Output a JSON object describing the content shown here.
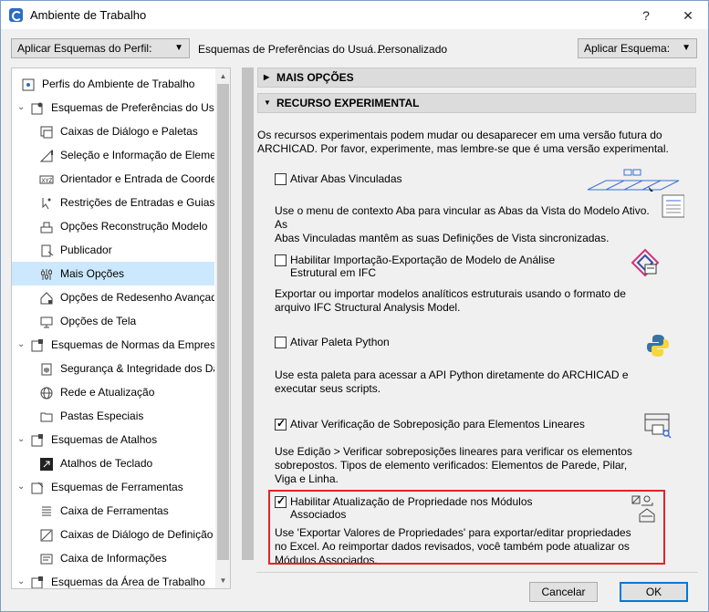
{
  "window": {
    "title": "Ambiente de Trabalho",
    "help_label": "?",
    "close_label": "✕"
  },
  "toolbar": {
    "apply_profile_label": "Aplicar Esquemas do Perfil:",
    "scheme_label": "Esquemas de Preferências do Usuá...:",
    "scheme_value": "Personalizado",
    "apply_scheme_label": "Aplicar Esquema:"
  },
  "tree": {
    "items": [
      {
        "label": "Perfis do Ambiente de Trabalho",
        "icon": "profiles-icon",
        "expand": ""
      },
      {
        "label": "Esquemas de Preferências do Usuá",
        "icon": "user-prefs-icon",
        "expand": "⌄"
      },
      {
        "label": "Caixas de Diálogo e Paletas",
        "icon": "dialogs-icon",
        "expand": ""
      },
      {
        "label": "Seleção e Informação de Element",
        "icon": "selection-info-icon",
        "expand": ""
      },
      {
        "label": "Orientador e Entrada de Coorder",
        "icon": "xyz-icon",
        "expand": ""
      },
      {
        "label": "Restrições de Entradas e Guias",
        "icon": "constraints-icon",
        "expand": ""
      },
      {
        "label": "Opções Reconstrução Modelo",
        "icon": "rebuild-icon",
        "expand": ""
      },
      {
        "label": "Publicador",
        "icon": "publisher-icon",
        "expand": ""
      },
      {
        "label": "Mais Opções",
        "icon": "more-options-icon",
        "expand": ""
      },
      {
        "label": "Opções de Redesenho Avançada",
        "icon": "redraw-icon",
        "expand": ""
      },
      {
        "label": "Opções de Tela",
        "icon": "screen-icon",
        "expand": ""
      },
      {
        "label": "Esquemas de Normas da Empresa",
        "icon": "company-standards-icon",
        "expand": "⌄"
      },
      {
        "label": "Segurança & Integridade dos Da",
        "icon": "security-icon",
        "expand": ""
      },
      {
        "label": "Rede e Atualização",
        "icon": "network-icon",
        "expand": ""
      },
      {
        "label": "Pastas Especiais",
        "icon": "folders-icon",
        "expand": ""
      },
      {
        "label": "Esquemas de Atalhos",
        "icon": "shortcuts-scheme-icon",
        "expand": "⌄"
      },
      {
        "label": "Atalhos de Teclado",
        "icon": "keyboard-shortcut-icon",
        "expand": ""
      },
      {
        "label": "Esquemas de Ferramentas",
        "icon": "tools-scheme-icon",
        "expand": "⌄"
      },
      {
        "label": "Caixa de Ferramentas",
        "icon": "toolbox-icon",
        "expand": ""
      },
      {
        "label": "Caixas de Diálogo de Definição d",
        "icon": "settings-dialogs-icon",
        "expand": ""
      },
      {
        "label": "Caixa de Informações",
        "icon": "info-box-icon",
        "expand": ""
      },
      {
        "label": "Esquemas da Área de Trabalho",
        "icon": "workspace-scheme-icon",
        "expand": "⌄"
      }
    ],
    "selected_index": 8
  },
  "panel": {
    "section_more": "MAIS OPÇÕES",
    "section_experimental": "RECURSO EXPERIMENTAL",
    "intro_line1": "Os recursos experimentais podem mudar ou desaparecer em uma versão futura do",
    "intro_line2": "ARCHICAD. Por favor, experimente, mas lembre-se que é uma versão experimental.",
    "options": [
      {
        "label": "Ativar Abas Vinculadas",
        "label2": "",
        "checked": false,
        "desc1": "Use o menu de contexto Aba para vincular as Abas da Vista do Modelo Ativo. As",
        "desc2": "Abas Vinculadas mantêm as suas Definições de Vista sincronizadas.",
        "desc3": "",
        "icon": "linked-tabs-icon"
      },
      {
        "label": "Habilitar Importação-Exportação de Modelo de Análise",
        "label2": "Estrutural em IFC",
        "checked": false,
        "desc1": "Exportar ou importar modelos analíticos estruturais usando o formato de",
        "desc2": "arquivo IFC Structural Analysis Model.",
        "desc3": "",
        "icon": "ifc-icon"
      },
      {
        "label": "Ativar Paleta Python",
        "label2": "",
        "checked": false,
        "desc1": "Use esta paleta para acessar a API Python diretamente do ARCHICAD e",
        "desc2": "executar seus scripts.",
        "desc3": "",
        "icon": "python-icon"
      },
      {
        "label": "Ativar Verificação de Sobreposição para Elementos Lineares",
        "label2": "",
        "checked": true,
        "desc1": "Use Edição > Verificar sobreposições lineares para verificar os elementos",
        "desc2": "sobrepostos. Tipos de elemento verificados: Elementos de Parede, Pilar,",
        "desc3": "Viga e Linha.",
        "icon": "overlap-check-icon"
      },
      {
        "label": "Habilitar Atualização de Propriedade nos Módulos",
        "label2": "Associados",
        "checked": true,
        "desc1": "Use 'Exportar Valores de Propriedades' para exportar/editar propriedades",
        "desc2": "no Excel. Ao reimportar dados revisados, você também pode atualizar os",
        "desc3": "Módulos Associados.",
        "icon": "property-update-icon"
      }
    ]
  },
  "footer": {
    "cancel_label": "Cancelar",
    "ok_label": "OK"
  }
}
